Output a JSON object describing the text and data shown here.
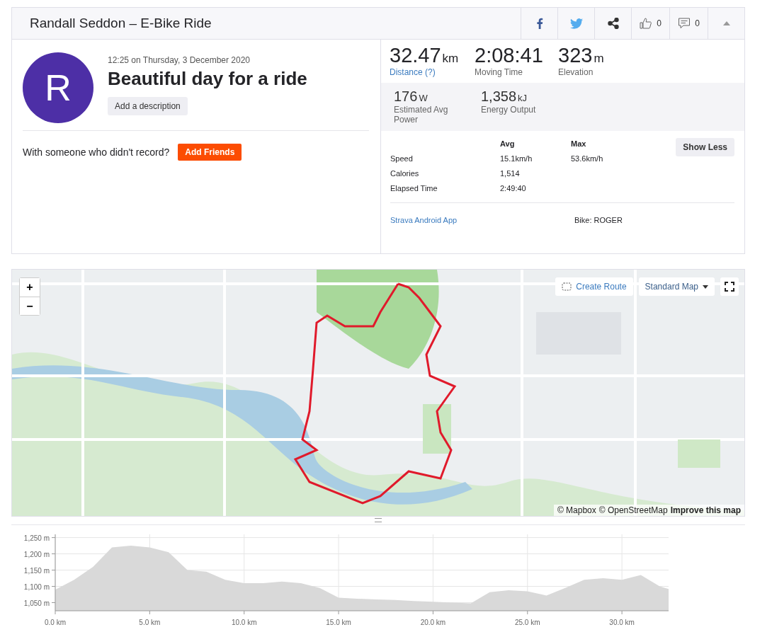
{
  "header": {
    "title": "Randall Seddon – E-Bike Ride",
    "kudos_count": "0",
    "comment_count": "0"
  },
  "activity": {
    "avatar_letter": "R",
    "datetime": "12:25 on Thursday, 3 December 2020",
    "title": "Beautiful day for a ride",
    "description_button": "Add a description",
    "prompt": "With someone who didn't record?",
    "add_friends_button": "Add Friends"
  },
  "stats": {
    "primary": [
      {
        "value": "32.47",
        "unit": "km",
        "label": "Distance (?)",
        "link": true
      },
      {
        "value": "2:08:41",
        "label": "Moving Time",
        "link": false
      },
      {
        "value": "323",
        "unit": "m",
        "label": "Elevation",
        "link": false
      }
    ],
    "secondary": [
      {
        "value": "176",
        "unit": "W",
        "label": "Estimated Avg Power"
      },
      {
        "value": "1,358",
        "unit": "kJ",
        "label": "Energy Output"
      }
    ],
    "columns": [
      "Avg",
      "Max"
    ],
    "rows": [
      {
        "label": "Speed",
        "avg": "15.1km/h",
        "max": "53.6km/h"
      },
      {
        "label": "Calories",
        "avg": "1,514"
      },
      {
        "label": "Elapsed Time",
        "avg": "2:49:40"
      }
    ],
    "toggle_button": "Show Less",
    "device": "Strava Android App",
    "bike": "Bike: ROGER"
  },
  "map": {
    "kind": "picture",
    "zoom_in": "+",
    "zoom_out": "−",
    "create_route": "Create Route",
    "map_style": "Standard Map",
    "attribution": [
      "© Mapbox",
      "© OpenStreetMap"
    ],
    "improve_link": "Improve this map"
  },
  "elevation": {
    "chart_data": {
      "type": "area",
      "x": [
        0,
        1,
        2,
        3,
        4,
        5,
        6,
        7,
        8,
        9,
        10,
        11,
        12,
        13,
        14,
        15,
        16,
        17,
        18,
        19,
        20,
        21,
        22,
        23,
        24,
        25,
        26,
        27,
        28,
        29,
        30,
        31,
        32,
        32.47
      ],
      "grid": true,
      "series": [
        {
          "color": "#d9d9d9",
          "values": [
            1090,
            1120,
            1160,
            1220,
            1225,
            1220,
            1205,
            1150,
            1145,
            1120,
            1110,
            1110,
            1115,
            1110,
            1095,
            1065,
            1062,
            1060,
            1058,
            1055,
            1053,
            1050,
            1048,
            1082,
            1088,
            1085,
            1072,
            1095,
            1120,
            1125,
            1120,
            1135,
            1100,
            1092
          ]
        }
      ],
      "xlim": [
        0,
        32.47
      ],
      "ylim": [
        1025,
        1260
      ],
      "xticks": [
        {
          "value": 0,
          "label": "0.0 km"
        },
        {
          "value": 5,
          "label": "5.0 km"
        },
        {
          "value": 10,
          "label": "10.0 km"
        },
        {
          "value": 15,
          "label": "15.0 km"
        },
        {
          "value": 20,
          "label": "20.0 km"
        },
        {
          "value": 25,
          "label": "25.0 km"
        },
        {
          "value": 30,
          "label": "30.0 km"
        }
      ],
      "yticks": [
        {
          "value": 1050,
          "label": "1,050 m"
        },
        {
          "value": 1100,
          "label": "1,100 m"
        },
        {
          "value": 1150,
          "label": "1,150 m"
        },
        {
          "value": 1200,
          "label": "1,200 m"
        },
        {
          "value": 1250,
          "label": "1,250 m"
        }
      ]
    }
  }
}
